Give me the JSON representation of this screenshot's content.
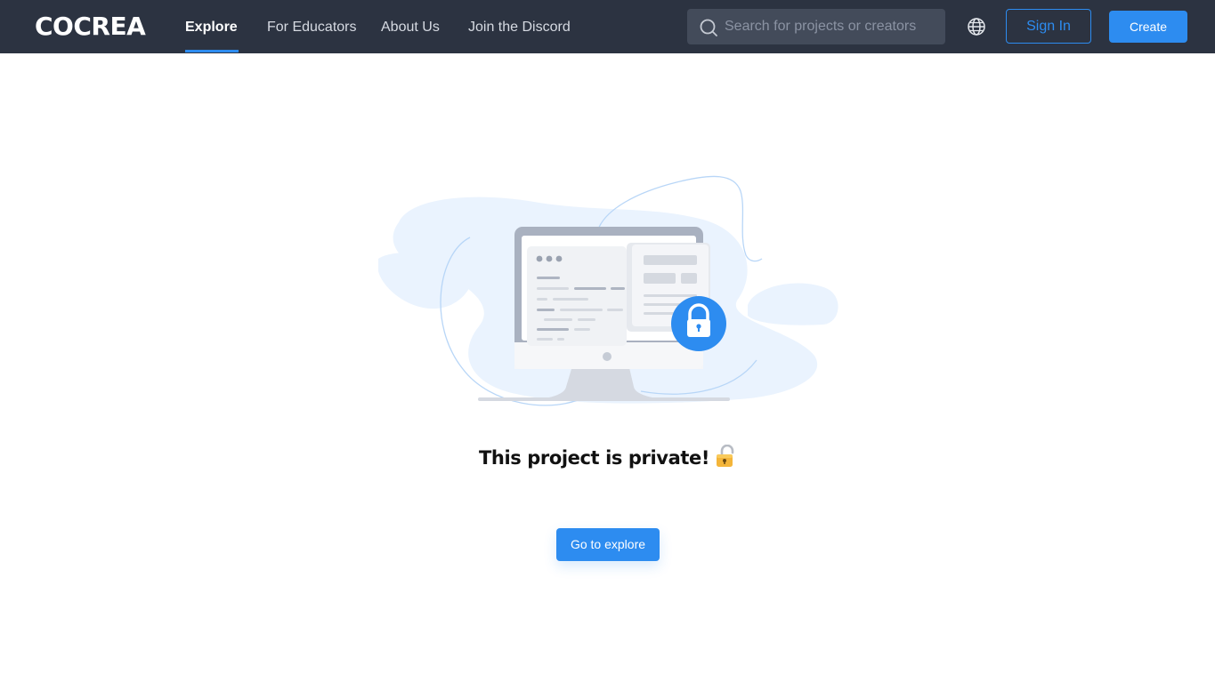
{
  "header": {
    "logo": "COCREA",
    "nav": [
      {
        "label": "Explore",
        "active": true
      },
      {
        "label": "For Educators",
        "active": false
      },
      {
        "label": "About Us",
        "active": false
      },
      {
        "label": "Join the Discord",
        "active": false
      }
    ],
    "search": {
      "placeholder": "Search for projects or creators",
      "value": "",
      "icon": "search-icon"
    },
    "language_icon": "globe-icon",
    "sign_in_label": "Sign In",
    "create_label": "Create"
  },
  "main": {
    "illustration": "private-project-illustration",
    "message": "This project is private!",
    "message_icon": "lock-emoji-icon",
    "explore_button_label": "Go to explore"
  },
  "colors": {
    "header_bg": "#2c3341",
    "accent": "#2d8cf0",
    "search_bg": "#434b5a"
  }
}
